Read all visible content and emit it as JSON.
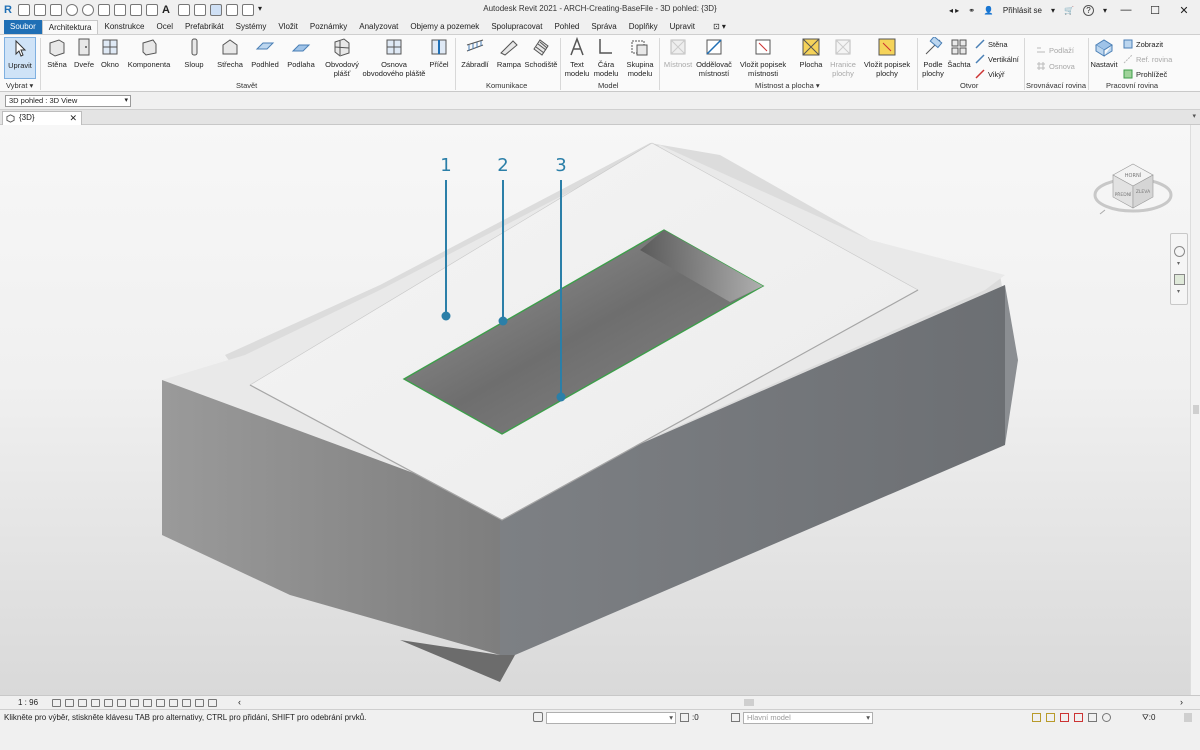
{
  "window": {
    "title": "Autodesk Revit 2021 - ARCH-Creating-BaseFile - 3D pohled: {3D}",
    "sign_in": "Přihlásit se",
    "help": "?"
  },
  "tabs": [
    "Soubor",
    "Architektura",
    "Konstrukce",
    "Ocel",
    "Prefabrikát",
    "Systémy",
    "Vložit",
    "Poznámky",
    "Analyzovat",
    "Objemy a pozemek",
    "Spolupracovat",
    "Pohled",
    "Správa",
    "Doplňky",
    "Upravit"
  ],
  "ribbon": {
    "modify": "Upravit",
    "select": "Vybrat",
    "build": {
      "label": "Stavět",
      "items": [
        "Stěna",
        "Dveře",
        "Okno",
        "Komponenta",
        "Sloup",
        "Střecha",
        "Podhled",
        "Podlaha",
        "Obvodový plášť",
        "Osnova obvodového pláště",
        "Příčel"
      ]
    },
    "circulation": {
      "label": "Komunikace",
      "items": [
        "Zábradlí",
        "Rampa",
        "Schodiště"
      ]
    },
    "model": {
      "label": "Model",
      "items": [
        "Text modelu",
        "Čára modelu",
        "Skupina modelu"
      ]
    },
    "room_area": {
      "label": "Místnost a plocha",
      "items": [
        "Místnost",
        "Oddělovač místností",
        "Vložit popisek místnosti",
        "Plocha",
        "Hranice plochy",
        "Vložit popisek plochy"
      ]
    },
    "opening": {
      "label": "Otvor",
      "items": [
        "Podle plochy",
        "Šachta"
      ],
      "small": [
        "Stěna",
        "Vertikální",
        "Vikýř"
      ]
    },
    "datum": {
      "label": "Srovnávací rovina",
      "small": [
        "Podlaží",
        "Osnova"
      ]
    },
    "workplane": {
      "label": "Pracovní rovina",
      "set": "Nastavit",
      "small": [
        "Zobrazit",
        "Ref. rovina",
        "Prohlížeč"
      ]
    }
  },
  "view_selector": "3D pohled : 3D View",
  "view_tab": "{3D}",
  "viewcube": {
    "top": "HORNÍ",
    "front": "PŘEDNÍ",
    "right": "ZLEVA"
  },
  "callouts": [
    "1",
    "2",
    "3"
  ],
  "view_bar": {
    "scale": "1 : 96"
  },
  "status": {
    "hint": "Klikněte pro výběr, stiskněte klávesu TAB pro alternativy, CTRL pro přidání, SHIFT pro odebrání prvků.",
    "selected": ":0",
    "model": "Hlavní model",
    "filter": ":0"
  },
  "colors": {
    "file_tab": "#1f6fb5",
    "callout": "#2b7fa8",
    "opening_edge": "#3d9e4a"
  }
}
